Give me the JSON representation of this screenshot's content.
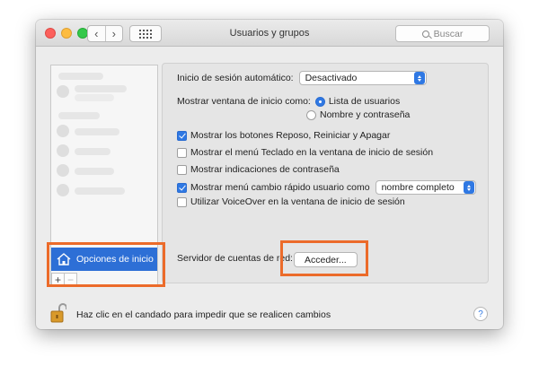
{
  "window": {
    "title": "Usuarios y grupos",
    "search_placeholder": "Buscar"
  },
  "nav": {
    "back": "‹",
    "forward": "›"
  },
  "sidebar": {
    "selected_item": "Opciones de inicio",
    "add": "+",
    "remove": "−"
  },
  "options": {
    "auto_login_label": "Inicio de sesión automático:",
    "auto_login_value": "Desactivado",
    "show_window_label": "Mostrar ventana de inicio como:",
    "radio_list": "Lista de usuarios",
    "radio_name": "Nombre y contraseña",
    "radio_selected": "Lista de usuarios",
    "cb_buttons": "Mostrar los botones Reposo, Reiniciar y Apagar",
    "cb_keyboard": "Mostrar el menú Teclado en la ventana de inicio de sesión",
    "cb_hints": "Mostrar indicaciones de contraseña",
    "cb_fast_switch": "Mostrar menú cambio rápido usuario como",
    "fast_switch_value": "nombre completo",
    "cb_voiceover": "Utilizar VoiceOver en la ventana de inicio de sesión",
    "checked": {
      "buttons": true,
      "keyboard": false,
      "hints": false,
      "fast_switch": true,
      "voiceover": false
    },
    "server_label": "Servidor de cuentas de red:",
    "join_button": "Acceder..."
  },
  "footer": {
    "lock_text": "Haz clic en el candado para impedir que se realicen cambios",
    "help": "?"
  },
  "colors": {
    "accent": "#2f78e3",
    "highlight": "#ec6b2a",
    "selection": "#2d6fd6"
  }
}
